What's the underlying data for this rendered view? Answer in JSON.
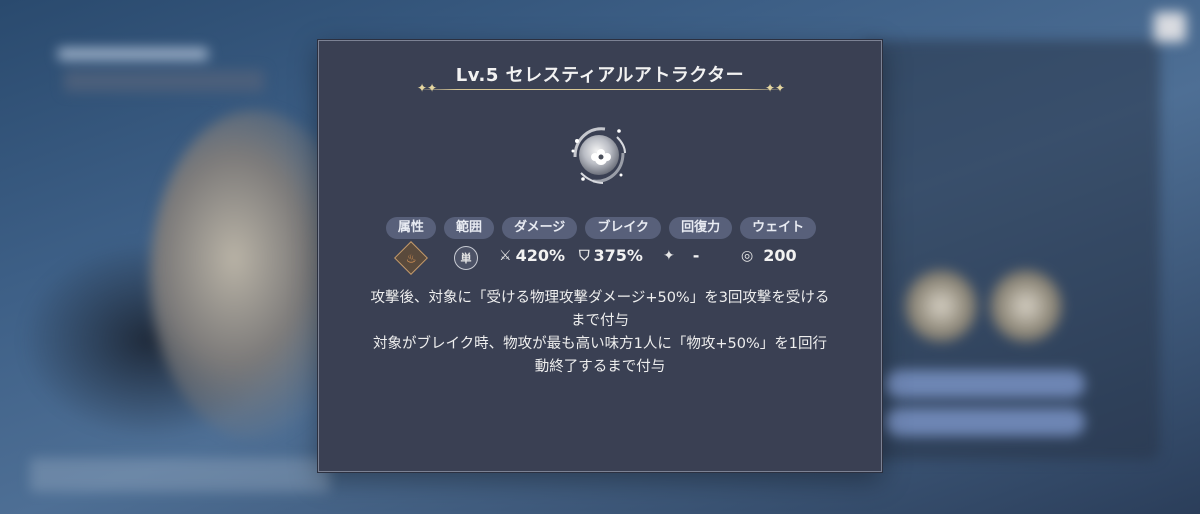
{
  "skill": {
    "title": "Lv.5 セレスティアルアトラクター",
    "icon": "celestial-orb-icon"
  },
  "stats": {
    "labels": [
      "属性",
      "範囲",
      "ダメージ",
      "ブレイク",
      "回復力",
      "ウェイト"
    ],
    "attribute_icon": "fire-attribute-icon",
    "range_value": "単",
    "damage_value": "420%",
    "break_value": "375%",
    "heal_value": "-",
    "wait_value": "200"
  },
  "description": {
    "line1": "攻撃後、対象に「受ける物理攻撃ダメージ+50%」を3回攻撃を受ける",
    "line2": "まで付与",
    "line3": "対象がブレイク時、物攻が最も高い味方1人に「物攻+50%」を1回行",
    "line4": "動終了するまで付与"
  },
  "colors": {
    "dialog_bg": "#3a4053",
    "pill_bg": "#58607a",
    "gold_accent": "#d8c896"
  }
}
